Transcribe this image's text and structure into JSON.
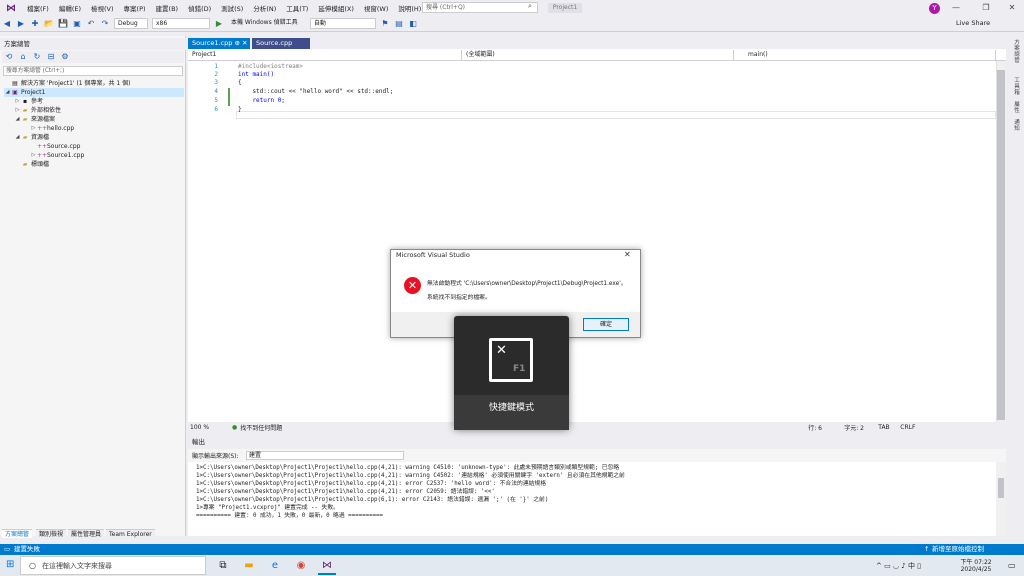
{
  "menu": {
    "items": [
      "檔案(F)",
      "編輯(E)",
      "檢視(V)",
      "專案(P)",
      "建置(B)",
      "偵錯(D)",
      "測試(S)",
      "分析(N)",
      "工具(T)",
      "延伸模組(X)",
      "視窗(W)",
      "說明(H)"
    ],
    "quick_search": "搜尋 (Ctrl+Q)",
    "solution_name": "Project1",
    "avatar": "Y"
  },
  "toolbar": {
    "config": "Debug",
    "platform": "x86",
    "debugger": "本機 Windows 偵錯工具",
    "auto": "自動",
    "live_share": "Live Share"
  },
  "solution_explorer": {
    "title": "方案總管",
    "search_placeholder": "搜尋方案總管 (Ctrl+;)",
    "tree": [
      {
        "label": "解決方案 'Project1' (1 個專案，共 1 個)",
        "indent": 0
      },
      {
        "label": "Project1",
        "indent": 1
      },
      {
        "label": "參考",
        "indent": 2
      },
      {
        "label": "外部相依性",
        "indent": 2
      },
      {
        "label": "來源檔案",
        "indent": 2
      },
      {
        "label": "hello.cpp",
        "indent": 3
      },
      {
        "label": "資源檔",
        "indent": 2
      },
      {
        "label": "Source.cpp",
        "indent": 3
      },
      {
        "label": "Source1.cpp",
        "indent": 3
      },
      {
        "label": "標頭檔",
        "indent": 2
      }
    ],
    "bottom_tabs": [
      "方案總管",
      "類別檢視",
      "屬性管理員",
      "Team Explorer"
    ]
  },
  "editor": {
    "tabs": [
      "Source1.cpp",
      "Source.cpp"
    ],
    "nav": {
      "project": "Project1",
      "scope": "(全域範圍)",
      "member": "main()"
    },
    "lines": [
      {
        "n": "1",
        "text": "#include<iostream>"
      },
      {
        "n": "2",
        "text": "int main()"
      },
      {
        "n": "3",
        "text": "{"
      },
      {
        "n": "4",
        "text": "    std::cout << \"hello word\" << std::endl;"
      },
      {
        "n": "5",
        "text": "    return 0;"
      },
      {
        "n": "6",
        "text": "}"
      }
    ],
    "zoom": "100 %",
    "issues": "找不到任何問題",
    "line": "行: 6",
    "col": "字元: 2",
    "tab": "TAB",
    "eol": "CRLF"
  },
  "right_strip": [
    "方案總管",
    "工具箱",
    "屬性",
    "通知"
  ],
  "output": {
    "title": "輸出",
    "source_label": "顯示輸出來源(S):",
    "source_value": "建置",
    "lines": [
      "1>C:\\Users\\owner\\Desktop\\Project1\\Project1\\hello.cpp(4,21): warning C4510: 'unknown-type': 此處未預期語言類別或類型規範; 已忽略",
      "1>C:\\Users\\owner\\Desktop\\Project1\\Project1\\hello.cpp(4,21): warning C4502: '連結規格' 必須使用關鍵字 'extern' 且必須在其他規範之前",
      "1>C:\\Users\\owner\\Desktop\\Project1\\Project1\\hello.cpp(4,21): error C2537: 'hello word': 不合法的連結規格",
      "1>C:\\Users\\owner\\Desktop\\Project1\\Project1\\hello.cpp(4,21): error C2059: 語法錯誤: '<<'",
      "1>C:\\Users\\owner\\Desktop\\Project1\\Project1\\hello.cpp(6,1): error C2143: 語法錯誤: 遺漏 ';' (在 '}' 之前)",
      "1>專案 \"Project1.vcxproj\" 建置完成 -- 失敗。",
      "========== 建置: 0 成功，1 失敗，0 最新，0 略過 =========="
    ]
  },
  "statusbar": {
    "left": "建置失敗",
    "right": "新增至原始檔控制"
  },
  "taskbar": {
    "search_placeholder": "在這裡輸入文字來搜尋",
    "time": "下午 07:22",
    "date": "2020/4/25"
  },
  "dialog": {
    "title": "Microsoft Visual Studio",
    "msg1": "無法啟動程式 'C:\\Users\\owner\\Desktop\\Project1\\Debug\\Project1.exe'。",
    "msg2": "系統找不到指定的檔案。",
    "ok": "確定"
  },
  "overlay": {
    "key": "F1",
    "label": "快捷鍵模式"
  }
}
